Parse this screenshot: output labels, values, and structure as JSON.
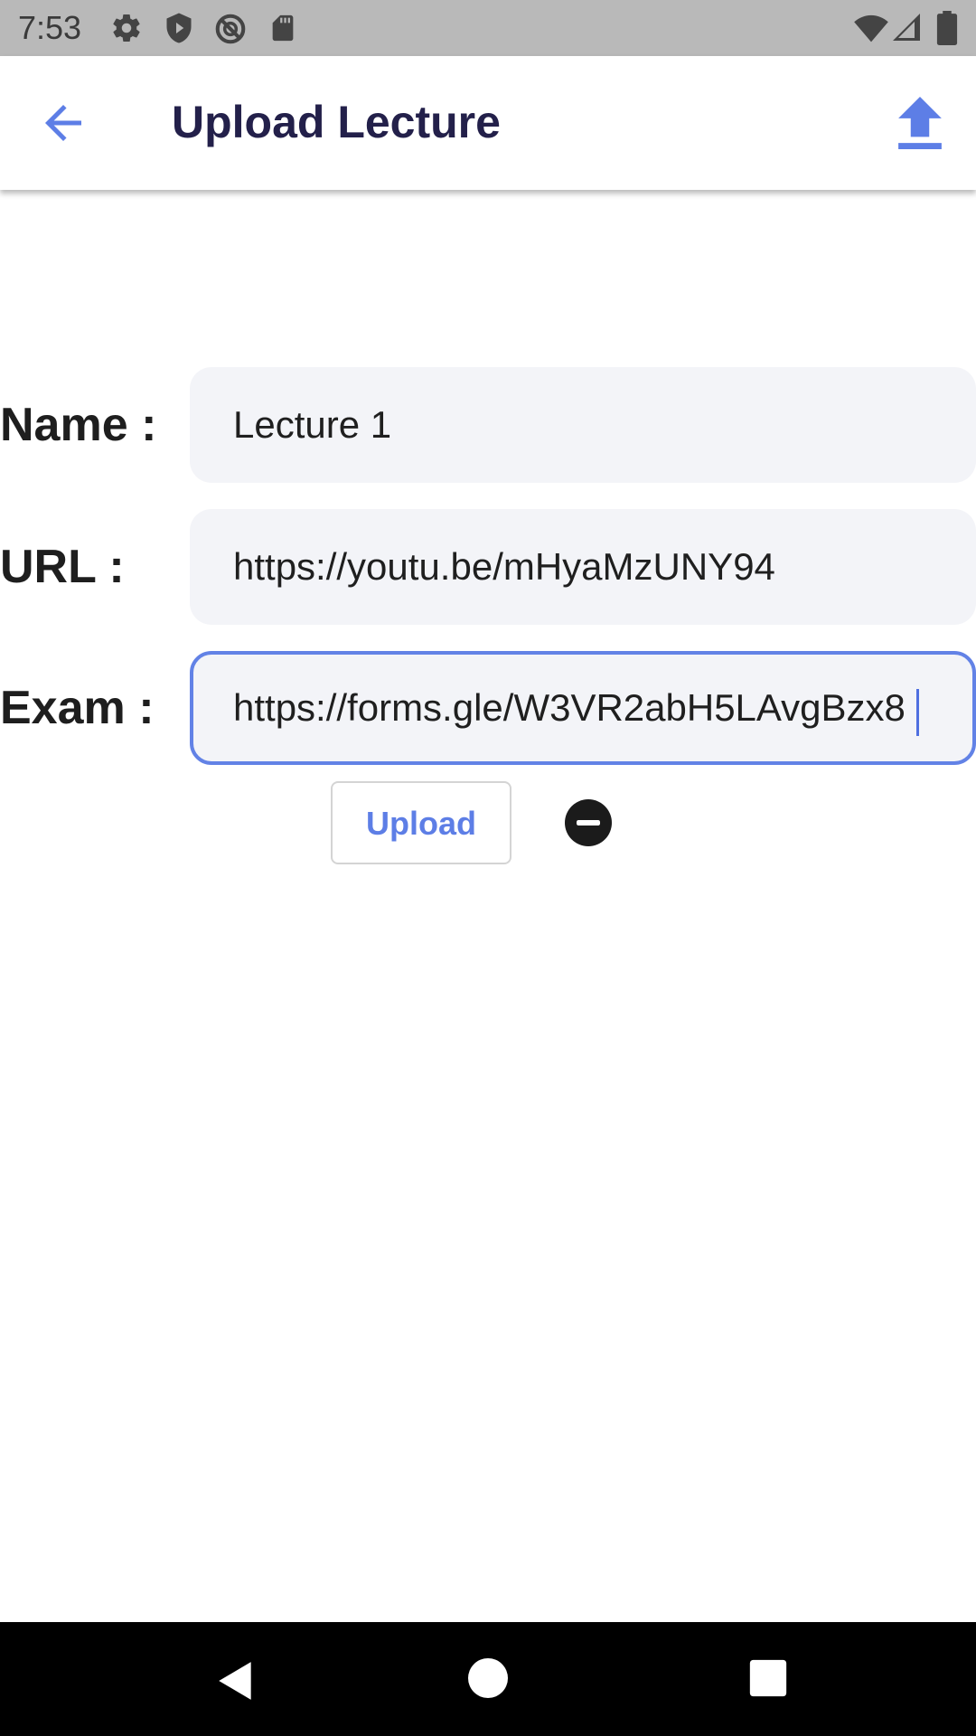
{
  "status_bar": {
    "time": "7:53",
    "left_icons": [
      "gear-icon",
      "shield-icon",
      "no-sync-icon",
      "sd-card-icon"
    ],
    "right_icons": [
      "wifi-icon",
      "signal-icon",
      "battery-icon"
    ]
  },
  "app_bar": {
    "title": "Upload Lecture",
    "back_icon": "arrow-left-icon",
    "action_icon": "upload-icon",
    "accent_color": "#5d7ee6"
  },
  "form": {
    "name": {
      "label": "Name :",
      "value": "Lecture 1"
    },
    "url": {
      "label": "URL :",
      "value": "https://youtu.be/mHyaMzUNY94"
    },
    "exam": {
      "label": "Exam :",
      "value": "https://forms.gle/W3VR2abH5LAvgBzx8",
      "focused": true
    }
  },
  "actions": {
    "upload_label": "Upload",
    "remove_icon": "minus-circle-icon"
  },
  "nav_bar": {
    "icons": [
      "back-triangle-icon",
      "home-circle-icon",
      "recents-square-icon"
    ]
  }
}
